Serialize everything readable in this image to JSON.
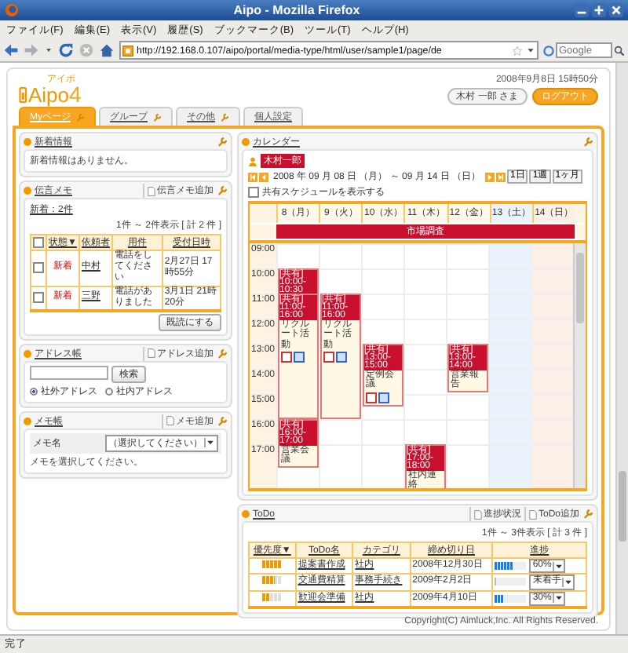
{
  "window": {
    "title": "Aipo - Mozilla Firefox"
  },
  "menu": [
    "ファイル(F)",
    "編集(E)",
    "表示(V)",
    "履歴(S)",
    "ブックマーク(B)",
    "ツール(T)",
    "ヘルプ(H)"
  ],
  "toolbar": {
    "url": "http://192.168.0.107/aipo/portal/media-type/html/user/sample1/page/de",
    "search": {
      "placeholder": "Google"
    }
  },
  "header": {
    "logo": "Aipo",
    "logo_version": "4",
    "logo_ruby": "アイポ",
    "datetime": "2008年9月8日 15時50分",
    "user": "木村 一郎 さま",
    "logout": "ログアウト"
  },
  "tabs": [
    {
      "label": "Myページ",
      "selected": true,
      "wrench": true
    },
    {
      "label": "グループ",
      "selected": false,
      "wrench": true
    },
    {
      "label": "その他",
      "selected": false,
      "wrench": true
    },
    {
      "label": "個人設定",
      "selected": false,
      "wrench": false
    }
  ],
  "news": {
    "title": "新着情報",
    "message": "新着情報はありません。"
  },
  "memos": {
    "title": "伝言メモ",
    "all_checked": false,
    "add": "伝言メモ追加",
    "new_count": "新着：2件",
    "range": "1件 ～ 2件表示 [ 計 2 件 ]",
    "columns": [
      "状態▼",
      "依頼者",
      "用件",
      "受付日時"
    ],
    "rows": [
      {
        "checked": false,
        "status": "新着",
        "from": "中村",
        "subject": "電話をしてください",
        "received": "2月27日 17時55分"
      },
      {
        "checked": false,
        "status": "新着",
        "from": "三野",
        "subject": "電話がありました",
        "received": "3月1日 21時20分"
      }
    ],
    "button": "既読にする"
  },
  "address": {
    "title": "アドレス帳",
    "add": "アドレス追加",
    "search_button": "検索",
    "options": [
      {
        "label": "社外アドレス",
        "selected": true
      },
      {
        "label": "社内アドレス",
        "selected": false
      }
    ]
  },
  "notepad": {
    "title": "メモ帳",
    "add": "メモ追加",
    "label": "メモ名",
    "select": "（選択してください）",
    "message": "メモを選択してください。"
  },
  "calendar": {
    "title": "カレンダー",
    "user": "木村一郎",
    "range": "2008 年 09 月 08 日 （月） ～ 09 月 14 日 （日）",
    "views": [
      "1日",
      "1週",
      "1ヶ月"
    ],
    "shared": {
      "label": "共有スケジュールを表示する",
      "checked": false
    },
    "all_day": "市場調査",
    "hours": [
      "09:00",
      "10:00",
      "11:00",
      "12:00",
      "13:00",
      "14:00",
      "15:00",
      "16:00",
      "17:00"
    ],
    "days": [
      {
        "label": "8（月）",
        "kind": "weekday",
        "events": [
          {
            "header": "[共有]",
            "time": "10:00-10:30",
            "icons": false
          },
          {
            "header": "[共有]",
            "time": "11:00-16:00",
            "body": "リクルート活動",
            "icons": true
          },
          {
            "header": "[共有]",
            "time": "16:00-17:00",
            "body": "営業会議",
            "icons": false
          }
        ]
      },
      {
        "label": "9（火）",
        "kind": "weekday",
        "events": [
          {
            "header": "[共有]",
            "time": "11:00-16:00",
            "body": "リクルート活動",
            "icons": true
          }
        ]
      },
      {
        "label": "10（水）",
        "kind": "weekday",
        "events": [
          {
            "header": "[共有]",
            "time": "13:00-15:00",
            "body": "定例会議",
            "icons": true
          }
        ]
      },
      {
        "label": "11（木）",
        "kind": "weekday",
        "events": [
          {
            "header": "[共有]",
            "time": "17:00-18:00",
            "body": "社内連絡",
            "icons": false
          }
        ]
      },
      {
        "label": "12（金）",
        "kind": "weekday",
        "events": [
          {
            "header": "[共有]",
            "time": "13:00-14:00",
            "body": "営業報告",
            "icons": false
          }
        ]
      },
      {
        "label": "13（土）",
        "kind": "saturday"
      },
      {
        "label": "14（日）",
        "kind": "sunday"
      }
    ]
  },
  "todo": {
    "title": "ToDo",
    "progress_link": "進捗状況",
    "add": "ToDo追加",
    "range": "1件 ～ 3件表示 [ 計 3 件 ]",
    "columns": [
      "優先度▼",
      "ToDo名",
      "カテゴリ",
      "締め切り日",
      "進捗"
    ],
    "rows": [
      {
        "priority": {
          "level": 1
        },
        "name": "提案書作成",
        "category": "社内",
        "due": "2008年12月30日",
        "progress": {
          "level": 0.6,
          "value": "60%"
        }
      },
      {
        "priority": {
          "level": 0.6
        },
        "name": "交通費精算",
        "category": "事務手続き",
        "due": "2009年2月2日",
        "progress": {
          "level": 0,
          "value": "未着手"
        }
      },
      {
        "priority": {
          "level": 0.4
        },
        "name": "歓迎会準備",
        "category": "社内",
        "due": "2009年4月10日",
        "progress": {
          "level": 0.3,
          "value": "30%"
        }
      }
    ]
  },
  "footer": {
    "copyright": "Copyright(C) Aimluck,Inc. All Rights Reserved."
  },
  "status_bar": "完了"
}
